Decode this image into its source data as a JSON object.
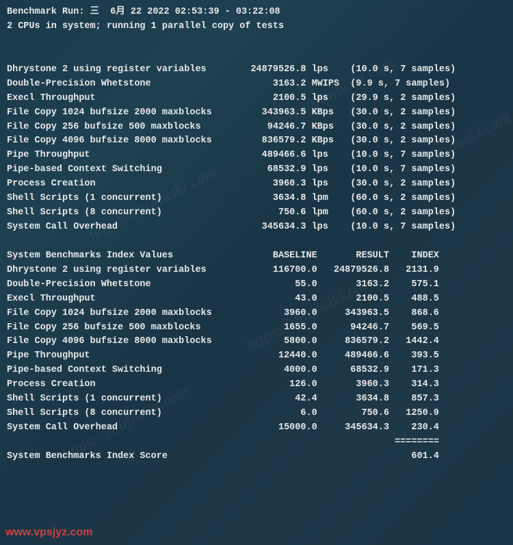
{
  "header": {
    "run_line": "Benchmark Run: 三  6月 22 2022 02:53:39 - 03:22:08",
    "cpu_line": "2 CPUs in system; running 1 parallel copy of tests"
  },
  "tests": [
    {
      "name": "Dhrystone 2 using register variables",
      "value": "24879526.8",
      "unit": "lps",
      "timing": "(10.0 s, 7 samples)"
    },
    {
      "name": "Double-Precision Whetstone",
      "value": "3163.2",
      "unit": "MWIPS",
      "timing": "(9.9 s, 7 samples)"
    },
    {
      "name": "Execl Throughput",
      "value": "2100.5",
      "unit": "lps",
      "timing": "(29.9 s, 2 samples)"
    },
    {
      "name": "File Copy 1024 bufsize 2000 maxblocks",
      "value": "343963.5",
      "unit": "KBps",
      "timing": "(30.0 s, 2 samples)"
    },
    {
      "name": "File Copy 256 bufsize 500 maxblocks",
      "value": "94246.7",
      "unit": "KBps",
      "timing": "(30.0 s, 2 samples)"
    },
    {
      "name": "File Copy 4096 bufsize 8000 maxblocks",
      "value": "836579.2",
      "unit": "KBps",
      "timing": "(30.0 s, 2 samples)"
    },
    {
      "name": "Pipe Throughput",
      "value": "489466.6",
      "unit": "lps",
      "timing": "(10.0 s, 7 samples)"
    },
    {
      "name": "Pipe-based Context Switching",
      "value": "68532.9",
      "unit": "lps",
      "timing": "(10.0 s, 7 samples)"
    },
    {
      "name": "Process Creation",
      "value": "3960.3",
      "unit": "lps",
      "timing": "(30.0 s, 2 samples)"
    },
    {
      "name": "Shell Scripts (1 concurrent)",
      "value": "3634.8",
      "unit": "lpm",
      "timing": "(60.0 s, 2 samples)"
    },
    {
      "name": "Shell Scripts (8 concurrent)",
      "value": "750.6",
      "unit": "lpm",
      "timing": "(60.0 s, 2 samples)"
    },
    {
      "name": "System Call Overhead",
      "value": "345634.3",
      "unit": "lps",
      "timing": "(10.0 s, 7 samples)"
    }
  ],
  "index_header": {
    "label": "System Benchmarks Index Values",
    "col1": "BASELINE",
    "col2": "RESULT",
    "col3": "INDEX"
  },
  "index_rows": [
    {
      "name": "Dhrystone 2 using register variables",
      "baseline": "116700.0",
      "result": "24879526.8",
      "index": "2131.9"
    },
    {
      "name": "Double-Precision Whetstone",
      "baseline": "55.0",
      "result": "3163.2",
      "index": "575.1"
    },
    {
      "name": "Execl Throughput",
      "baseline": "43.0",
      "result": "2100.5",
      "index": "488.5"
    },
    {
      "name": "File Copy 1024 bufsize 2000 maxblocks",
      "baseline": "3960.0",
      "result": "343963.5",
      "index": "868.6"
    },
    {
      "name": "File Copy 256 bufsize 500 maxblocks",
      "baseline": "1655.0",
      "result": "94246.7",
      "index": "569.5"
    },
    {
      "name": "File Copy 4096 bufsize 8000 maxblocks",
      "baseline": "5800.0",
      "result": "836579.2",
      "index": "1442.4"
    },
    {
      "name": "Pipe Throughput",
      "baseline": "12440.0",
      "result": "489466.6",
      "index": "393.5"
    },
    {
      "name": "Pipe-based Context Switching",
      "baseline": "4000.0",
      "result": "68532.9",
      "index": "171.3"
    },
    {
      "name": "Process Creation",
      "baseline": "126.0",
      "result": "3960.3",
      "index": "314.3"
    },
    {
      "name": "Shell Scripts (1 concurrent)",
      "baseline": "42.4",
      "result": "3634.8",
      "index": "857.3"
    },
    {
      "name": "Shell Scripts (8 concurrent)",
      "baseline": "6.0",
      "result": "750.6",
      "index": "1250.9"
    },
    {
      "name": "System Call Overhead",
      "baseline": "15000.0",
      "result": "345634.3",
      "index": "230.4"
    }
  ],
  "divider": "========",
  "score": {
    "label": "System Benchmarks Index Score",
    "value": "601.4"
  },
  "watermarks": {
    "diag": "https://zhujiwiki.com",
    "bottom": "www.vpsjyz.com"
  }
}
